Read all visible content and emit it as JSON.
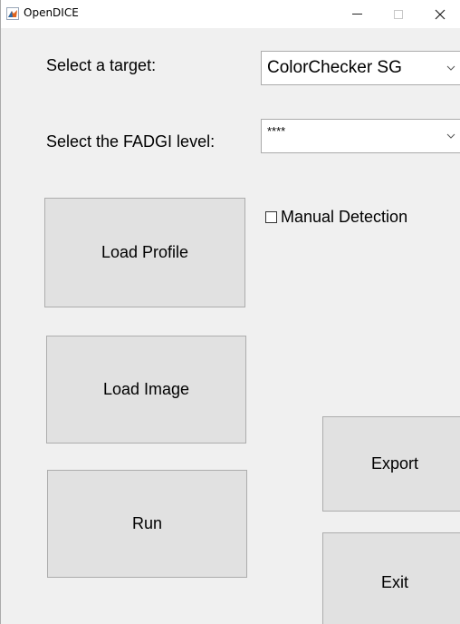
{
  "window": {
    "title": "OpenDICE",
    "controls": {
      "minimize": "minimize",
      "maximize": "maximize",
      "close": "close"
    },
    "icon": "matlab-icon"
  },
  "target": {
    "label": "Select a target:",
    "selected": "ColorChecker SG"
  },
  "fadgi": {
    "label": "Select the FADGI level:",
    "selected": "****"
  },
  "manual_detection": {
    "label": "Manual Detection",
    "checked": false
  },
  "buttons": {
    "load_profile": "Load Profile",
    "load_image": "Load Image",
    "run": "Run",
    "export": "Export",
    "exit": "Exit"
  }
}
